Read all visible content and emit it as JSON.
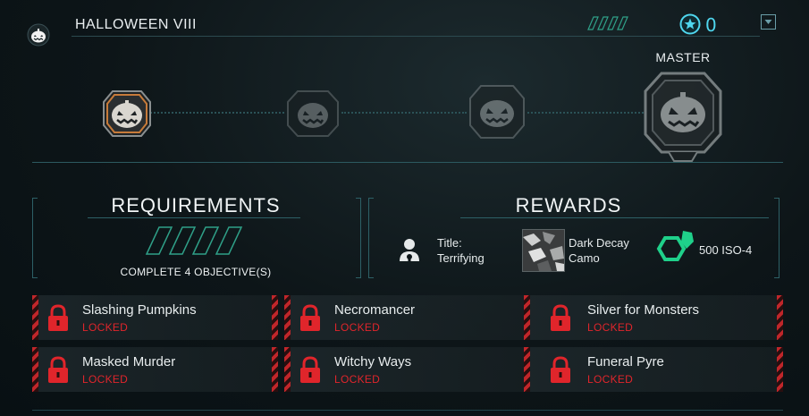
{
  "header": {
    "title": "HALLOWEEN VIII",
    "star_count": "0"
  },
  "tiers": {
    "label": "MASTER"
  },
  "requirements": {
    "title": "REQUIREMENTS",
    "progress_text": "COMPLETE 4 OBJECTIVE(S)"
  },
  "rewards": {
    "title": "REWARDS",
    "title_reward_line1": "Title:",
    "title_reward_line2": "Terrifying",
    "camo_line1": "Dark Decay",
    "camo_line2": "Camo",
    "iso_amount": "500 ISO-4"
  },
  "objectives": [
    {
      "name": "Slashing Pumpkins",
      "status": "LOCKED"
    },
    {
      "name": "Necromancer",
      "status": "LOCKED"
    },
    {
      "name": "Silver for Monsters",
      "status": "LOCKED"
    },
    {
      "name": "Masked Murder",
      "status": "LOCKED"
    },
    {
      "name": "Witchy Ways",
      "status": "LOCKED"
    },
    {
      "name": "Funeral Pyre",
      "status": "LOCKED"
    }
  ],
  "colors": {
    "accent": "#4fd6ee",
    "locked": "#e0252b",
    "iso": "#1fd08a"
  }
}
